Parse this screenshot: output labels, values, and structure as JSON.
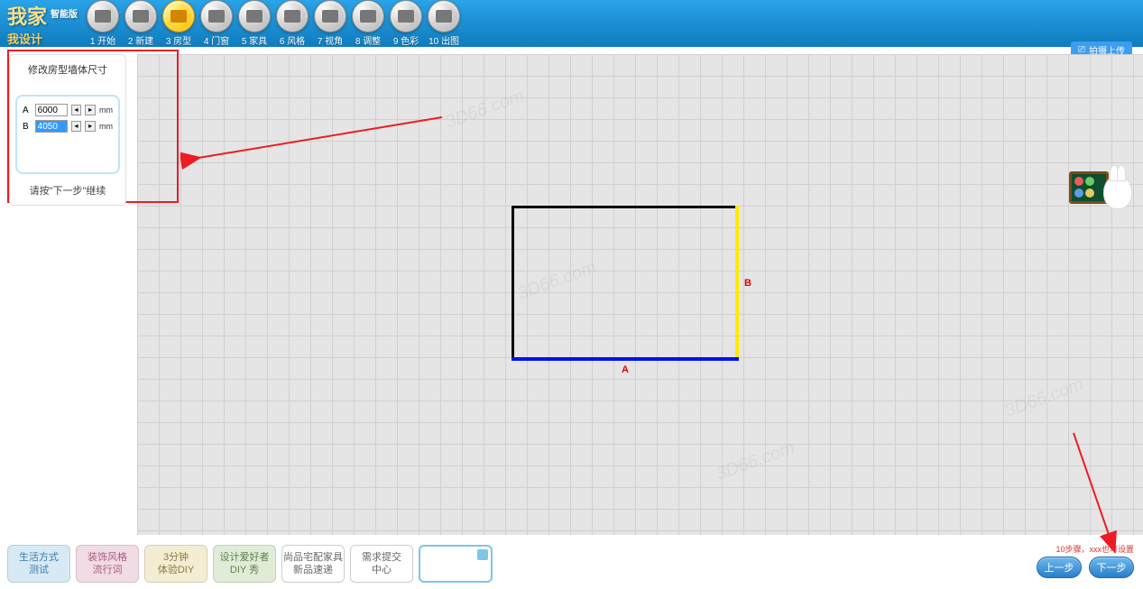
{
  "app": {
    "logo_main": "我家",
    "logo_sub": "智能版",
    "logo_script": "我设计"
  },
  "steps": [
    {
      "label": "1 开始"
    },
    {
      "label": "2 新建"
    },
    {
      "label": "3 房型"
    },
    {
      "label": "4 门窗"
    },
    {
      "label": "5 家具"
    },
    {
      "label": "6 风格"
    },
    {
      "label": "7 视角"
    },
    {
      "label": "8 调整"
    },
    {
      "label": "9 色彩"
    },
    {
      "label": "10 出图"
    }
  ],
  "active_step": 2,
  "top_right": "拍摄上传",
  "panel": {
    "title": "修改房型墙体尺寸",
    "rows": [
      {
        "label": "A",
        "value": "6000",
        "unit": "mm",
        "selected": false
      },
      {
        "label": "B",
        "value": "4050",
        "unit": "mm",
        "selected": true
      }
    ],
    "hint": "请按\"下一步\"继续"
  },
  "room": {
    "marker_a": "A",
    "marker_b": "B"
  },
  "bottom_tabs": [
    {
      "line1": "生活方式",
      "line2": "测试",
      "cls": "blue"
    },
    {
      "line1": "装饰风格",
      "line2": "流行词",
      "cls": "pink"
    },
    {
      "line1": "3分钟",
      "line2": "体验DIY",
      "cls": "yellow"
    },
    {
      "line1": "设计爱好者",
      "line2": "DIY 秀",
      "cls": "green"
    },
    {
      "line1": "尚品宅配家具",
      "line2": "新品速递",
      "cls": "white"
    },
    {
      "line1": "需求提交",
      "line2": "中心",
      "cls": "white"
    }
  ],
  "nav": {
    "prev": "上一步",
    "next": "下一步"
  },
  "tiny_note": "10步骤，xxx也可设置",
  "watermark": "3D66.com"
}
